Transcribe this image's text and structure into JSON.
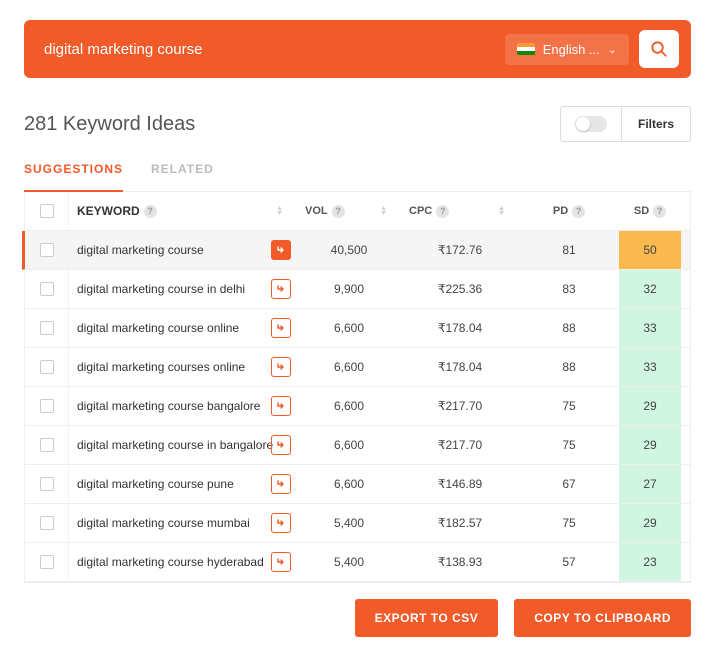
{
  "search": {
    "value": "digital marketing course",
    "language": "English ..."
  },
  "ideas_count_label": "281 Keyword Ideas",
  "filters_label": "Filters",
  "tabs": {
    "suggestions": "Suggestions",
    "related": "Related"
  },
  "columns": {
    "keyword": "Keyword",
    "vol": "Vol",
    "cpc": "CPC",
    "pd": "PD",
    "sd": "SD"
  },
  "rows": [
    {
      "keyword": "digital marketing course",
      "vol": "40,500",
      "cpc": "₹172.76",
      "pd": "81",
      "sd": "50",
      "sd_class": "sd-orange",
      "selected": true
    },
    {
      "keyword": "digital marketing course in delhi",
      "vol": "9,900",
      "cpc": "₹225.36",
      "pd": "83",
      "sd": "32",
      "sd_class": "sd-green"
    },
    {
      "keyword": "digital marketing course online",
      "vol": "6,600",
      "cpc": "₹178.04",
      "pd": "88",
      "sd": "33",
      "sd_class": "sd-green"
    },
    {
      "keyword": "digital marketing courses online",
      "vol": "6,600",
      "cpc": "₹178.04",
      "pd": "88",
      "sd": "33",
      "sd_class": "sd-green"
    },
    {
      "keyword": "digital marketing course bangalore",
      "vol": "6,600",
      "cpc": "₹217.70",
      "pd": "75",
      "sd": "29",
      "sd_class": "sd-green"
    },
    {
      "keyword": "digital marketing course in bangalore",
      "vol": "6,600",
      "cpc": "₹217.70",
      "pd": "75",
      "sd": "29",
      "sd_class": "sd-green"
    },
    {
      "keyword": "digital marketing course pune",
      "vol": "6,600",
      "cpc": "₹146.89",
      "pd": "67",
      "sd": "27",
      "sd_class": "sd-green"
    },
    {
      "keyword": "digital marketing course mumbai",
      "vol": "5,400",
      "cpc": "₹182.57",
      "pd": "75",
      "sd": "29",
      "sd_class": "sd-green"
    },
    {
      "keyword": "digital marketing course hyderabad",
      "vol": "5,400",
      "cpc": "₹138.93",
      "pd": "57",
      "sd": "23",
      "sd_class": "sd-green"
    }
  ],
  "buttons": {
    "export": "Export to CSV",
    "copy": "Copy to Clipboard"
  }
}
